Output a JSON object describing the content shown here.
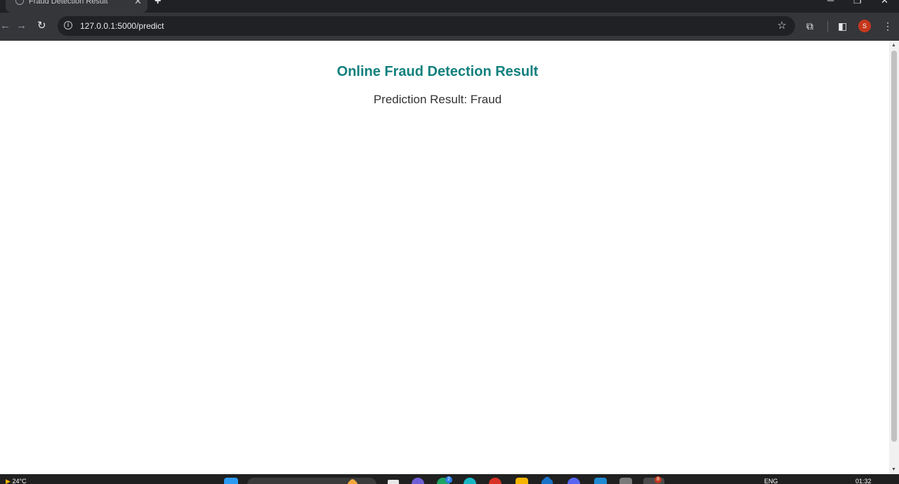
{
  "browser": {
    "tab_title": "Fraud Detection Result",
    "url": "127.0.0.1:5000/predict",
    "profile_initial": "S"
  },
  "page": {
    "heading": "Online Fraud Detection Result",
    "result_label": "Prediction Result: Fraud",
    "heading_color": "#11807e"
  },
  "taskbar": {
    "weather": "24°C",
    "language": "ENG",
    "time": "01:32",
    "mail_badge": "2",
    "app_badge": "8"
  }
}
